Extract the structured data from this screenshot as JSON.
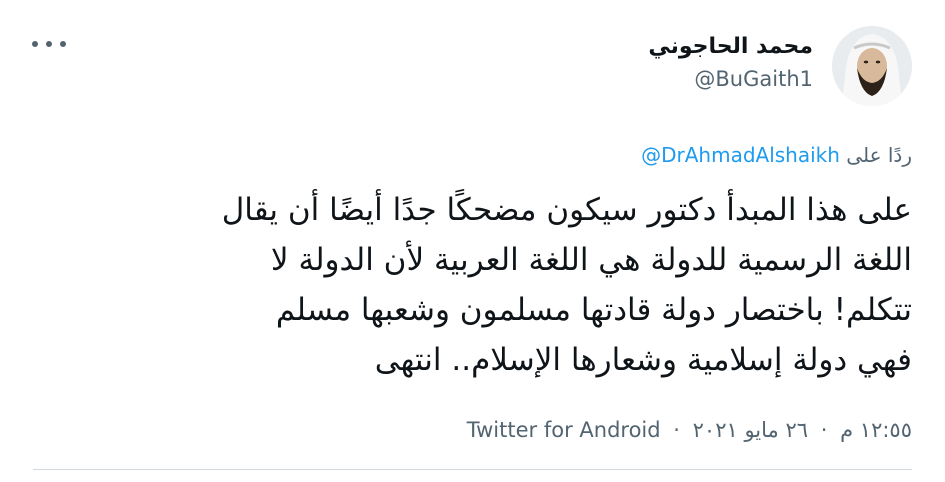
{
  "author": {
    "display_name": "محمد الحاجوني",
    "handle": "@BuGaith1"
  },
  "reply": {
    "prefix": "ردًا على",
    "mention": "@DrAhmadAlshaikh"
  },
  "tweet": {
    "lines": [
      "على هذا المبدأ دكتور سيكون مضحكًا جدًا أيضًا أن يقال",
      "اللغة الرسمية للدولة هي اللغة العربية لأن الدولة لا",
      "تتكلم! باختصار دولة قادتها مسلمون وشعبها مسلم",
      "فهي دولة إسلامية وشعارها الإسلام.. انتهى"
    ]
  },
  "meta": {
    "time": "١٢:٥٥ م",
    "date": "٢٦ مايو ٢٠٢١",
    "separator": "·",
    "source": "Twitter for Android"
  },
  "icons": {
    "more": "more-horizontal-icon"
  },
  "colors": {
    "text": "#0f1419",
    "secondary": "#536471",
    "link": "#1d9bf0"
  }
}
